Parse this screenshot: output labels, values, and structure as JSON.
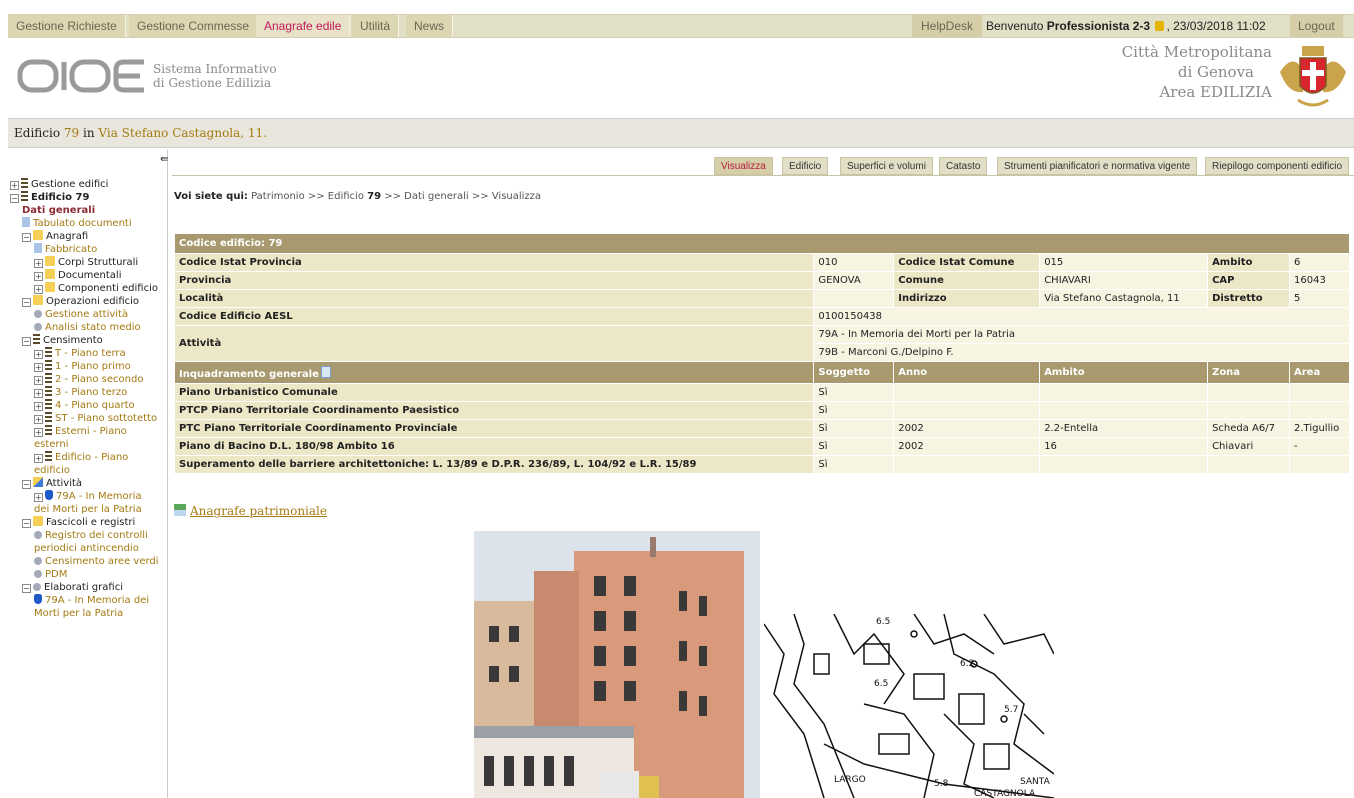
{
  "topnav": {
    "tabs": [
      {
        "label": "Gestione Richieste"
      },
      {
        "label": "Gestione Commesse"
      },
      {
        "label": "Anagrafe edile"
      },
      {
        "label": "Utilità"
      },
      {
        "label": "News"
      }
    ],
    "helpdesk": "HelpDesk",
    "welcome_prefix": "Benvenuto",
    "user": "Professionista 2-3",
    "datetime": ", 23/03/2018 11:02",
    "logout": "Logout"
  },
  "header": {
    "logo_text": "SIGE",
    "sub1": "Sistema Informativo",
    "sub2": "di Gestione Edilizia",
    "org1": "Città Metropolitana",
    "org2": "di Genova",
    "org3": "Area EDILIZIA"
  },
  "building_bar": {
    "prefix": "Edificio",
    "id": "79",
    "mid": "in",
    "address": "Via Stefano Castagnola, 11."
  },
  "sidebar": {
    "gestione_edifici": "Gestione edifici",
    "edificio": "Edificio 79",
    "dati_generali": "Dati generali",
    "tabulato": "Tabulato documenti",
    "anagrafi": "Anagrafi",
    "fabbricato": "Fabbricato",
    "corpi": "Corpi Strutturali",
    "documentali": "Documentali",
    "componenti": "Componenti edificio",
    "operazioni": "Operazioni edificio",
    "gestione_attivita": "Gestione attività",
    "analisi": "Analisi stato medio",
    "censimento": "Censimento",
    "piano_t": "T - Piano terra",
    "piano_1": "1 - Piano primo",
    "piano_2": "2 - Piano secondo",
    "piano_3": "3 - Piano terzo",
    "piano_4": "4 - Piano quarto",
    "piano_st": "ST - Piano sottotetto",
    "esterni": "Esterni - Piano esterni",
    "edificio_piano": "Edificio - Piano edificio",
    "attivita": "Attività",
    "att_79a": "79A - In Memoria dei Morti per la Patria",
    "fascicoli": "Fascicoli e registri",
    "registro": "Registro dei controlli periodici antincendio",
    "cens_verdi": "Censimento aree verdi",
    "pdm": "PDM",
    "elaborati": "Elaborati grafici",
    "elab_79a": "79A - In Memoria dei Morti per la Patria"
  },
  "subtabs": [
    {
      "label": "Visualizza"
    },
    {
      "label": "Edificio"
    },
    {
      "label": "Superfici e volumi"
    },
    {
      "label": "Catasto"
    },
    {
      "label": "Strumenti pianificatori e normativa vigente"
    },
    {
      "label": "Riepilogo componenti edificio"
    }
  ],
  "breadcrumb": {
    "lead": "Voi siete qui:",
    "path1": "Patrimonio >> Edificio",
    "bold": "79",
    "path2": ">> Dati generali >> Visualizza"
  },
  "table": {
    "title": "Codice edificio: 79",
    "rows": {
      "istat_prov_label": "Codice Istat Provincia",
      "istat_prov": "010",
      "istat_com_label": "Codice Istat Comune",
      "istat_com": "015",
      "ambito_label": "Ambito",
      "ambito": "6",
      "provincia_label": "Provincia",
      "provincia": "GENOVA",
      "comune_label": "Comune",
      "comune": "CHIAVARI",
      "cap_label": "CAP",
      "cap": "16043",
      "localita_label": "Località",
      "indirizzo_label": "Indirizzo",
      "indirizzo": "Via Stefano Castagnola, 11",
      "distretto_label": "Distretto",
      "distretto": "5",
      "aesl_label": "Codice Edificio AESL",
      "aesl": "0100150438",
      "attivita_label": "Attività",
      "att1": "79A - In Memoria dei Morti per la Patria",
      "att2": "79B - Marconi G./Delpino F."
    },
    "section": {
      "title": "Inquadramento generale",
      "soggetto": "Soggetto",
      "anno": "Anno",
      "ambito": "Ambito",
      "zona": "Zona",
      "area": "Area"
    },
    "planning": [
      {
        "name": "Piano Urbanistico Comunale",
        "sogg": "Sì",
        "anno": "",
        "ambito": "",
        "zona": "",
        "area": ""
      },
      {
        "name": "PTCP Piano Territoriale Coordinamento Paesistico",
        "sogg": "Sì",
        "anno": "",
        "ambito": "",
        "zona": "",
        "area": ""
      },
      {
        "name": "PTC Piano Territoriale Coordinamento Provinciale",
        "sogg": "Sì",
        "anno": "2002",
        "ambito": "2.2-Entella",
        "zona": "Scheda A6/7",
        "area": "2.Tigullio"
      },
      {
        "name": "Piano di Bacino D.L. 180/98 Ambito 16",
        "sogg": "Sì",
        "anno": "2002",
        "ambito": "16",
        "zona": "Chiavari",
        "area": "-"
      },
      {
        "name": "Superamento delle barriere architettoniche: L. 13/89 e D.P.R. 236/89, L. 104/92 e L.R. 15/89",
        "sogg": "Sì",
        "anno": "",
        "ambito": "",
        "zona": "",
        "area": ""
      }
    ]
  },
  "anagrafe_link": "Anagrafe patrimoniale",
  "map_labels": [
    "6.5",
    "6.2",
    "6.5",
    "5.7",
    "5.8",
    "SANTA",
    "LARGO",
    "CASTAGNOLA"
  ]
}
